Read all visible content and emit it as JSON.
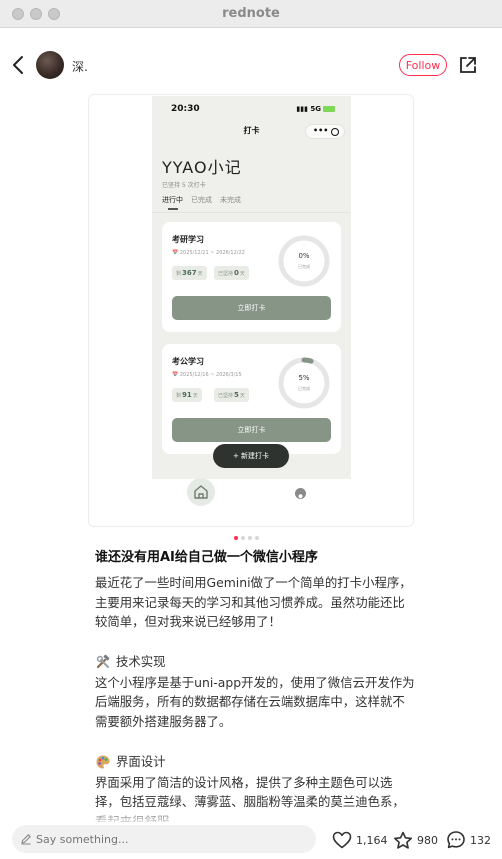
{
  "window": {
    "title": "rednote"
  },
  "header": {
    "author": "深.",
    "follow_label": "Follow"
  },
  "screenshot": {
    "status_time": "20:30",
    "status_signal": "5G",
    "nav_title": "打卡",
    "capsule_dots": "•••",
    "app_title": "YYAO小记",
    "subtitle": "已坚持 5 次打卡",
    "tabs": [
      "进行中",
      "已完成",
      "未完成"
    ],
    "cards": [
      {
        "title": "考研学习",
        "date": "2025/12/21 ~ 2026/12/22",
        "chip1_prefix": "剩",
        "chip1_value": "367",
        "chip1_suffix": "天",
        "chip2_prefix": "已坚持",
        "chip2_value": "0",
        "chip2_suffix": "天",
        "progress_label": "0%",
        "progress_sub": "已完成",
        "progress": 0,
        "button": "立即打卡"
      },
      {
        "title": "考公学习",
        "date": "2025/12/16 ~ 2026/3/15",
        "chip1_prefix": "剩",
        "chip1_value": "91",
        "chip1_suffix": "天",
        "chip2_prefix": "已坚持",
        "chip2_value": "5",
        "chip2_suffix": "天",
        "progress_label": "5%",
        "progress_sub": "已完成",
        "progress": 0.05,
        "button": "立即打卡"
      }
    ],
    "fab_label": "+ 新建打卡"
  },
  "carousel": {
    "count": 4,
    "active": 0
  },
  "post": {
    "title": "谁还没有用AI给自己做一个微信小程序",
    "intro": "最近花了一些时间用Gemini做了一个简单的打卡小程序，主要用来记录每天的学习和其他习惯养成。虽然功能还比较简单，但对我来说已经够用了！",
    "section1_title": "技术实现",
    "section1_body": "这个小程序是基于uni-app开发的，使用了微信云开发作为后端服务，所有的数据都存储在云端数据库中，这样就不需要额外搭建服务器了。",
    "section2_title": "界面设计",
    "section2_body": "界面采用了简洁的设计风格，提供了多种主题色可以选择，包括豆蔻绿、薄雾蓝、胭脂粉等温柔的莫兰迪色系，看起来很舒服。"
  },
  "bottom": {
    "comment_placeholder": "Say something...",
    "likes": "1,164",
    "stars": "980",
    "comments": "132"
  },
  "colors": {
    "brand": "#ff2e4d",
    "accent": "#869585",
    "fab": "#2f3330"
  }
}
